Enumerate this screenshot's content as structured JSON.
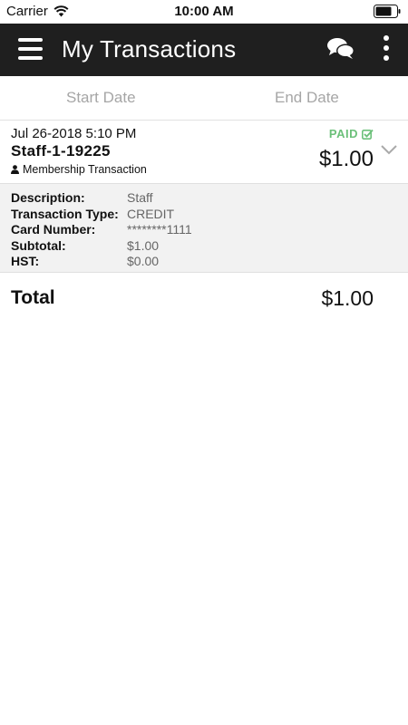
{
  "status_bar": {
    "carrier": "Carrier",
    "time": "10:00 AM"
  },
  "app_bar": {
    "title": "My Transactions",
    "icons": [
      "menu-icon",
      "chat-icon",
      "more-vertical-icon"
    ]
  },
  "filters": {
    "start_date_placeholder": "Start Date",
    "end_date_placeholder": "End Date"
  },
  "transaction": {
    "date": "Jul 26-2018 5:10 PM",
    "id": "Staff-1-19225",
    "type": "Membership Transaction",
    "status": "PAID",
    "status_color": "#6cc07a",
    "amount": "$1.00",
    "details": [
      {
        "label": "Description:",
        "value": "Staff"
      },
      {
        "label": "Transaction Type:",
        "value": "CREDIT"
      },
      {
        "label": "Card Number:",
        "value": "********1111"
      },
      {
        "label": "Subtotal:",
        "value": "$1.00"
      },
      {
        "label": "HST:",
        "value": "$0.00"
      }
    ]
  },
  "total": {
    "label": "Total",
    "amount": "$1.00"
  }
}
